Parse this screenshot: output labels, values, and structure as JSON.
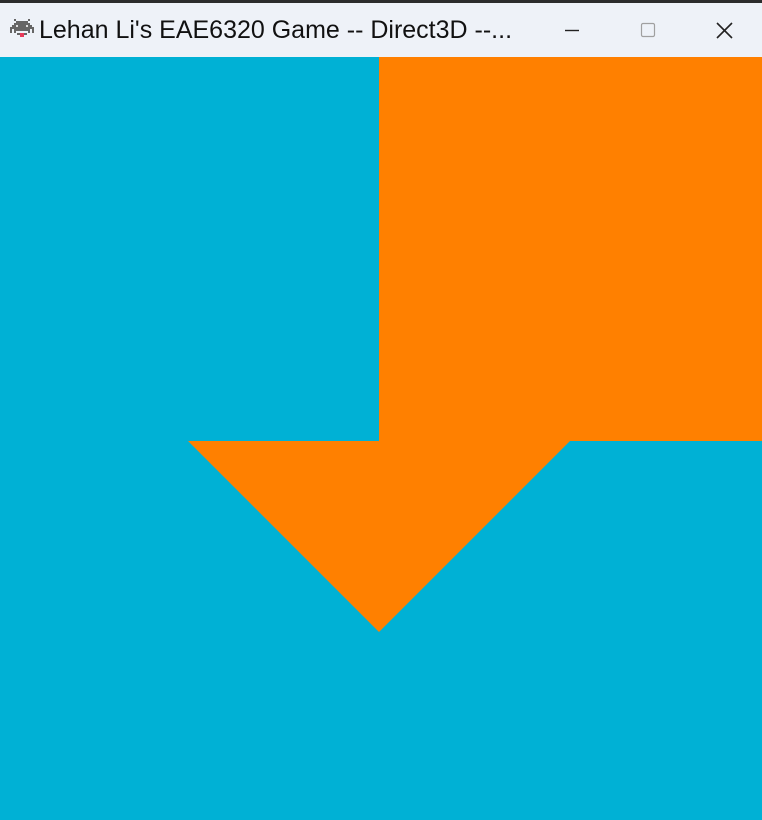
{
  "window": {
    "title": "Lehan Li's EAE6320 Game -- Direct3D --...",
    "icon": "space-invader-icon",
    "controls": [
      "minimize-icon",
      "maximize-icon",
      "close-icon"
    ]
  },
  "scene": {
    "background_color": "#00b1d5",
    "shape_color": "#ff8000",
    "shape": "arrow-down-icon"
  }
}
